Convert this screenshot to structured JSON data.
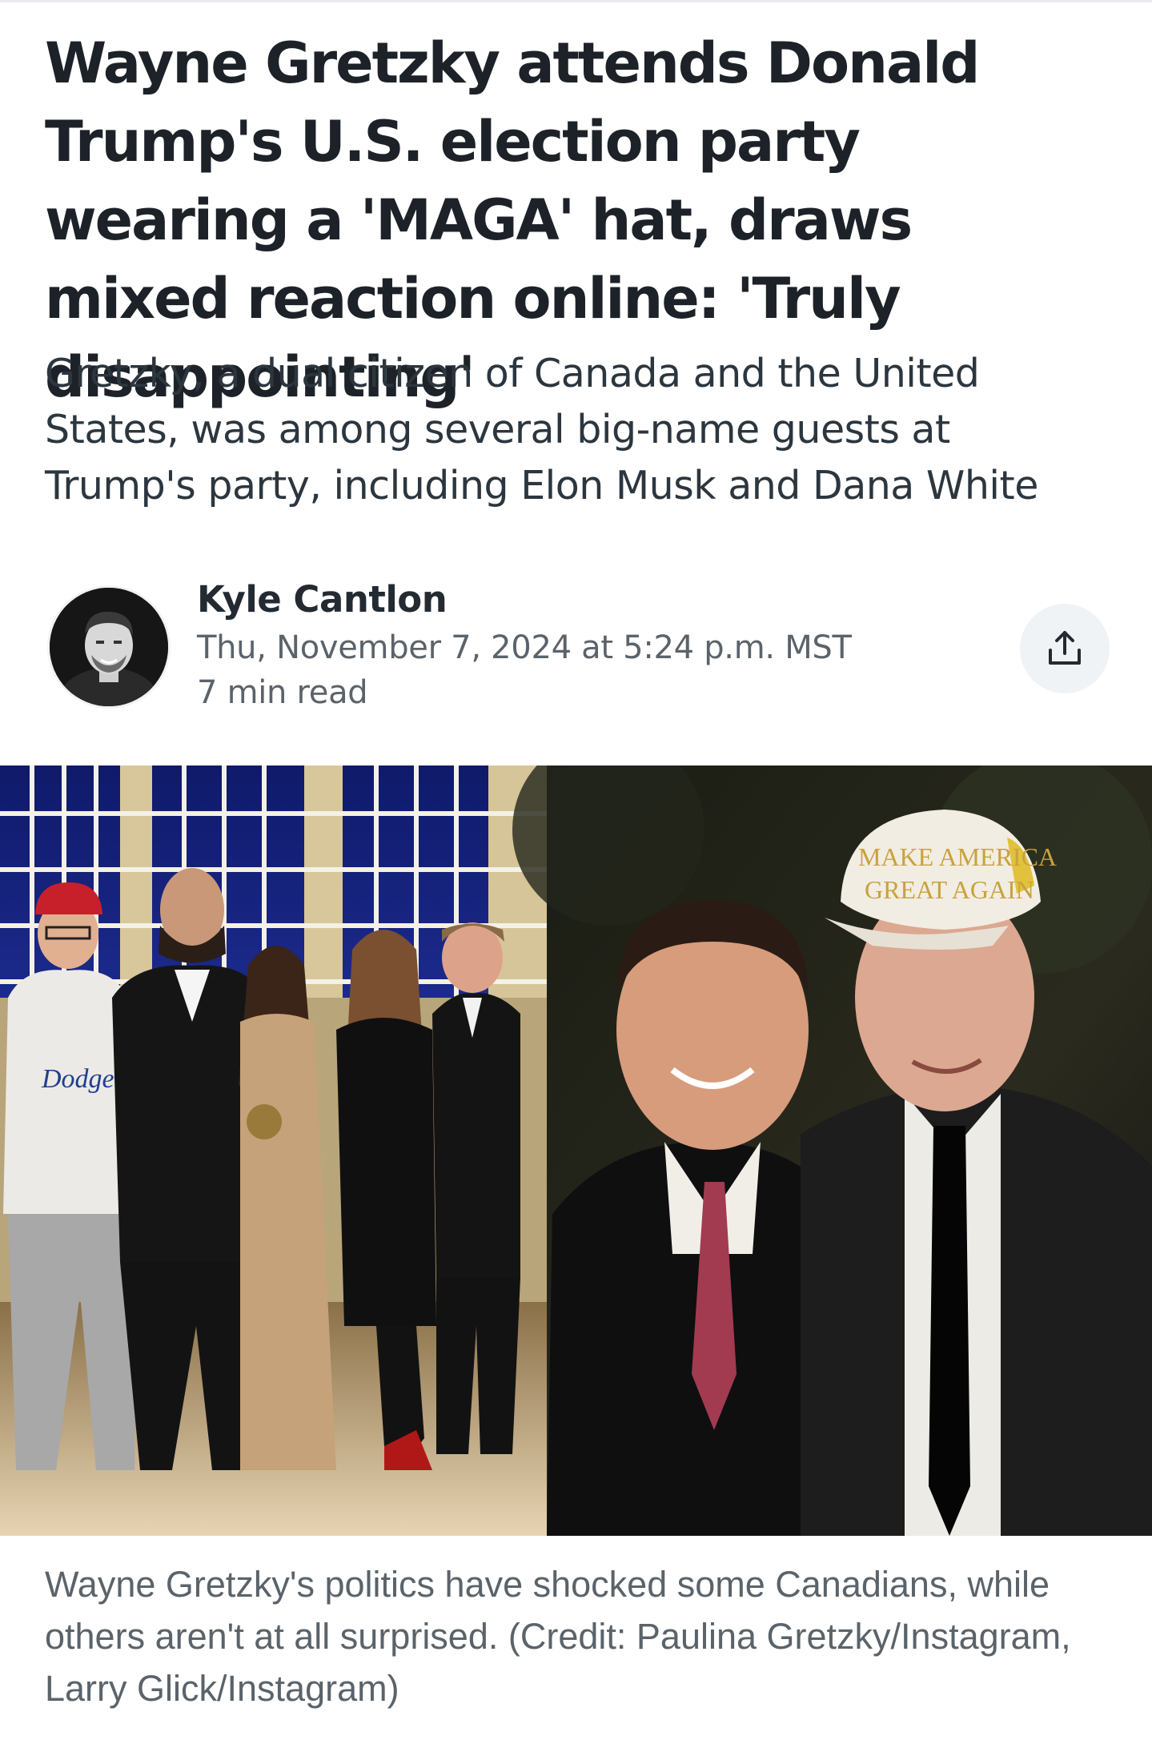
{
  "article": {
    "headline": "Wayne Gretzky attends Donald Trump's U.S. election party wearing a 'MAGA' hat, draws mixed reaction online: 'Truly disappointing'",
    "subheadline": "Gretzky, a dual citizen of Canada and the United States, was among several big-name guests at Trump's party, including Elon Musk and Dana White"
  },
  "byline": {
    "author": "Kyle Cantlon",
    "date": "Thu, November 7, 2024 at 5:24 p.m. MST",
    "read_time": "7 min read"
  },
  "photo": {
    "left_hat_text": "MAKE AMERICA GREAT AGAIN",
    "right_hat_line1": "MAKE AMERICA",
    "right_hat_line2": "GREAT AGAIN",
    "shirt_text": "Dodgers"
  },
  "caption": "Wayne Gretzky's politics have shocked some Canadians, while others aren't at all surprised. (Credit: Paulina Gretzky/Instagram, Larry Glick/Instagram)",
  "icons": {
    "share": "share-upload-icon",
    "avatar": "author-avatar"
  },
  "colors": {
    "headline": "#1d2228",
    "secondary_text": "#5b636a",
    "share_bg": "#f0f3f5"
  }
}
